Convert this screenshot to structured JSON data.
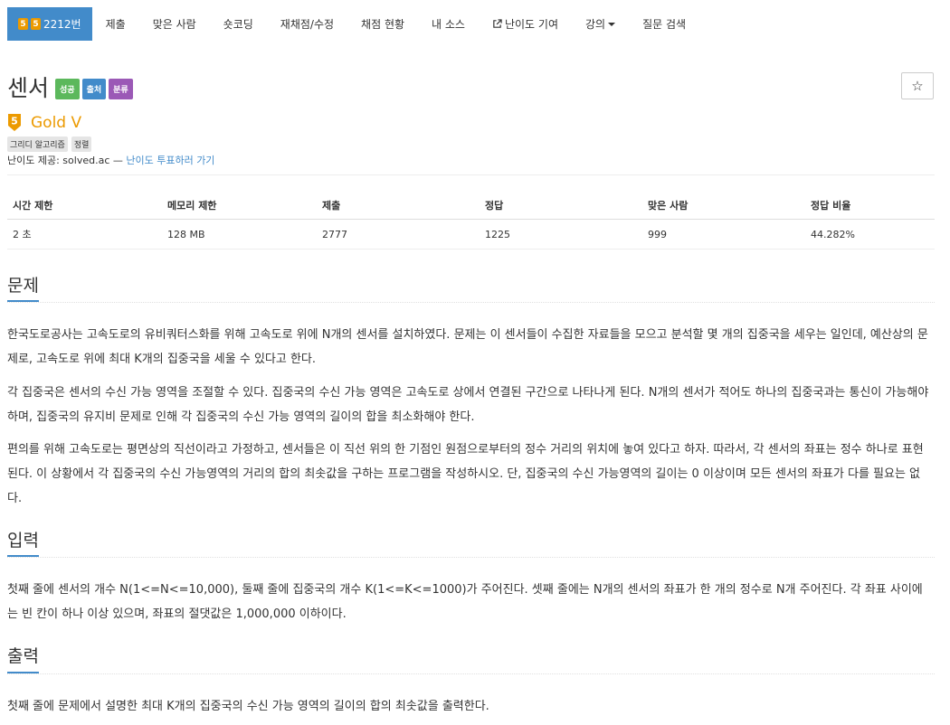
{
  "nav": {
    "tabs": [
      {
        "label": "2212번",
        "badges": [
          "5",
          "5"
        ]
      },
      {
        "label": "제출"
      },
      {
        "label": "맞은 사람"
      },
      {
        "label": "숏코딩"
      },
      {
        "label": "재채점/수정"
      },
      {
        "label": "채점 현황"
      },
      {
        "label": "내 소스"
      },
      {
        "label": "난이도 기여"
      },
      {
        "label": "강의"
      },
      {
        "label": "질문 검색"
      }
    ]
  },
  "problem": {
    "title": "센서",
    "labels": [
      "성공",
      "출처",
      "분류"
    ],
    "star": "☆"
  },
  "tier": {
    "number": "5",
    "name": "Gold V",
    "color": "#ec9a00"
  },
  "tags": [
    "그리디 알고리즘",
    "정렬"
  ],
  "difficulty": {
    "prefix": "난이도 제공: solved.ac — ",
    "link": "난이도 투표하러 가기"
  },
  "table": {
    "headers": [
      "시간 제한",
      "메모리 제한",
      "제출",
      "정답",
      "맞은 사람",
      "정답 비율"
    ],
    "row": [
      "2 초",
      "128 MB",
      "2777",
      "1225",
      "999",
      "44.282%"
    ]
  },
  "sections": {
    "problem": {
      "title": "문제",
      "paragraphs": [
        "한국도로공사는 고속도로의 유비쿼터스화를 위해 고속도로 위에 N개의 센서를 설치하였다. 문제는 이 센서들이 수집한 자료들을 모으고 분석할 몇 개의 집중국을 세우는 일인데, 예산상의 문제로, 고속도로 위에 최대 K개의 집중국을 세울 수 있다고 한다.",
        "각 집중국은 센서의 수신 가능 영역을 조절할 수 있다. 집중국의 수신 가능 영역은 고속도로 상에서 연결된 구간으로 나타나게 된다. N개의 센서가 적어도 하나의 집중국과는 통신이 가능해야 하며, 집중국의 유지비 문제로 인해 각 집중국의 수신 가능 영역의 길이의 합을 최소화해야 한다.",
        "편의를 위해 고속도로는 평면상의 직선이라고 가정하고, 센서들은 이 직선 위의 한 기점인 원점으로부터의 정수 거리의 위치에 놓여 있다고 하자. 따라서, 각 센서의 좌표는 정수 하나로 표현된다. 이 상황에서 각 집중국의 수신 가능영역의 거리의 합의 최솟값을 구하는 프로그램을 작성하시오. 단, 집중국의 수신 가능영역의 길이는 0 이상이며 모든 센서의 좌표가 다를 필요는 없다."
      ]
    },
    "input": {
      "title": "입력",
      "paragraphs": [
        "첫째 줄에 센서의 개수 N(1<=N<=10,000), 둘째 줄에 집중국의 개수 K(1<=K<=1000)가 주어진다. 셋째 줄에는 N개의 센서의 좌표가 한 개의 정수로 N개 주어진다. 각 좌표 사이에는 빈 칸이 하나 이상 있으며, 좌표의 절댓값은 1,000,000 이하이다."
      ]
    },
    "output": {
      "title": "출력",
      "paragraphs": [
        "첫째 줄에 문제에서 설명한 최대 K개의 집중국의 수신 가능 영역의 길이의 합의 최솟값을 출력한다."
      ]
    }
  },
  "colors": {
    "primary": "#428bca",
    "success": "#5cb85c",
    "purple": "#9b59b6",
    "gold": "#ec9a00"
  }
}
